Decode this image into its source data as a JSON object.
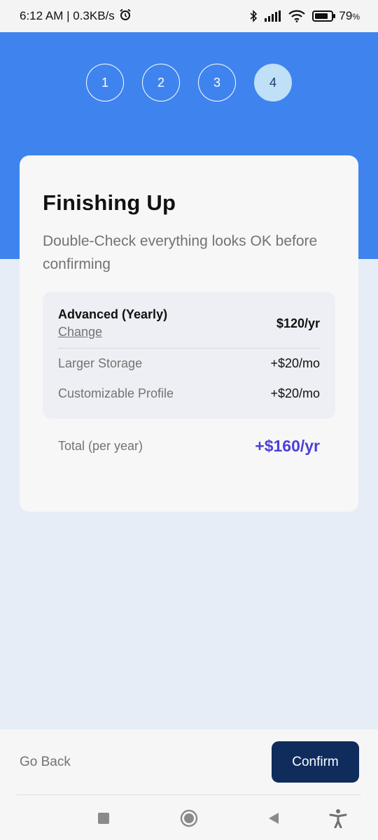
{
  "status_bar": {
    "time_speed": "6:12 AM | 0.3KB/s",
    "battery": "79",
    "icons": [
      "alarm-icon",
      "bluetooth-icon",
      "signal-icon",
      "wifi-icon",
      "battery-icon"
    ]
  },
  "steps": [
    "1",
    "2",
    "3",
    "4"
  ],
  "active_step": 4,
  "card": {
    "title": "Finishing Up",
    "subtitle": "Double-Check everything looks OK before confirming"
  },
  "summary": {
    "plan_name": "Advanced (Yearly)",
    "change_label": "Change",
    "plan_price": "$120/yr",
    "addons": [
      {
        "name": "Larger Storage",
        "price": "+$20/mo"
      },
      {
        "name": "Customizable Profile",
        "price": "+$20/mo"
      }
    ]
  },
  "total": {
    "label": "Total (per year)",
    "value": "+$160/yr"
  },
  "footer": {
    "back_label": "Go Back",
    "confirm_label": "Confirm"
  },
  "colors": {
    "banner": "#3f84ee",
    "confirm": "#0f2c5c",
    "total": "#4c3fd6",
    "active_step": "#bfe0f6"
  }
}
